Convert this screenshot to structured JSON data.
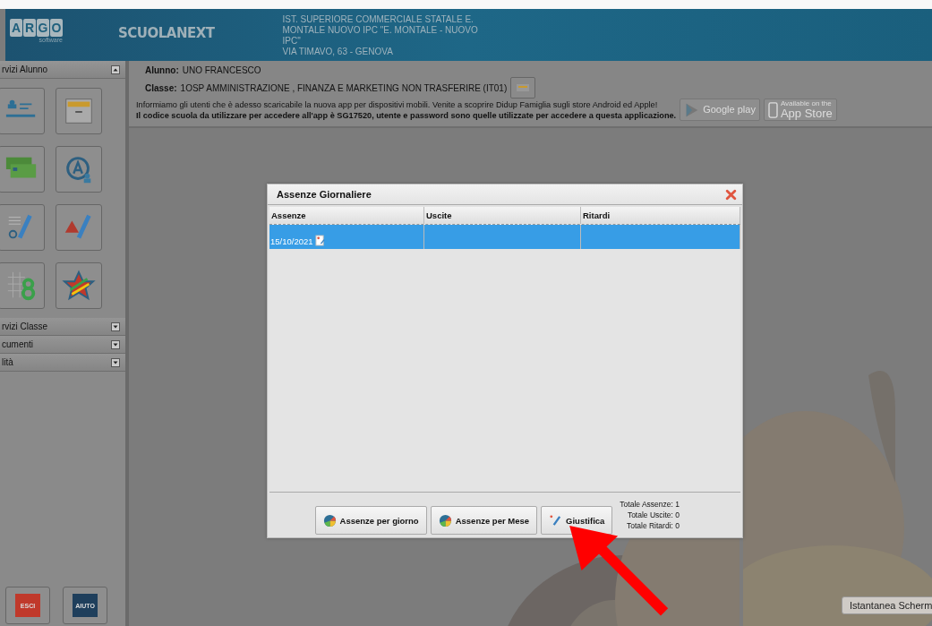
{
  "header": {
    "logo_letters": [
      "A",
      "R",
      "G",
      "O"
    ],
    "logo_sub": "software",
    "app_name": "SCUOLANEXT",
    "school_lines": [
      "IST. SUPERIORE COMMERCIALE STATALE E.",
      "MONTALE NUOVO IPC \"E. MONTALE - NUOVO",
      "IPC\"",
      "VIA TIMAVO, 63 - GENOVA"
    ]
  },
  "sidebar": {
    "sections": [
      {
        "title": "rvizi Alunno",
        "expanded": true
      },
      {
        "title": "rvizi Classe",
        "expanded": false
      },
      {
        "title": "cumenti",
        "expanded": false
      },
      {
        "title": "lità",
        "expanded": false
      }
    ],
    "bottom_buttons": [
      {
        "label": "ESCI",
        "color": "#c0392b"
      },
      {
        "label": "AIUTO",
        "color": "#1f3f5c"
      }
    ]
  },
  "info": {
    "student_label": "Alunno:",
    "student": "UNO FRANCESCO",
    "class_label": "Classe:",
    "class": "1OSP AMMINISTRAZIONE , FINANZA E MARKETING NON TRASFERIRE (IT01)",
    "notice": "Informiamo gli utenti che è adesso scaricabile la nuova app per dispositivi mobili. Venite a scoprire Didup Famiglia sugli store Android ed Apple!",
    "notice_bold": "Il codice scuola da utilizzare per accedere all'app è SG17520, utente e password sono quelle utilizzate per accedere a questa applicazione.",
    "stores": [
      {
        "kind": "google",
        "name": "Google play"
      },
      {
        "kind": "apple",
        "caption": "Available on the",
        "name": "App Store"
      }
    ]
  },
  "dialog": {
    "title": "Assenze Giornaliere",
    "columns": [
      "Assenze",
      "Uscite",
      "Ritardi"
    ],
    "rows": [
      {
        "cells": [
          "15/10/2021",
          "",
          ""
        ],
        "selected": true
      }
    ],
    "buttons": [
      {
        "kind": "chart",
        "label": "Assenze per giorno"
      },
      {
        "kind": "chart",
        "label": "Assenze per Mese"
      },
      {
        "kind": "edit",
        "label": "Giustifica"
      }
    ],
    "totals": [
      "Totale Assenze: 1",
      "Totale Uscite: 0",
      "Totale Ritardi: 0"
    ]
  },
  "tooltip": "Istantanea Scherm"
}
